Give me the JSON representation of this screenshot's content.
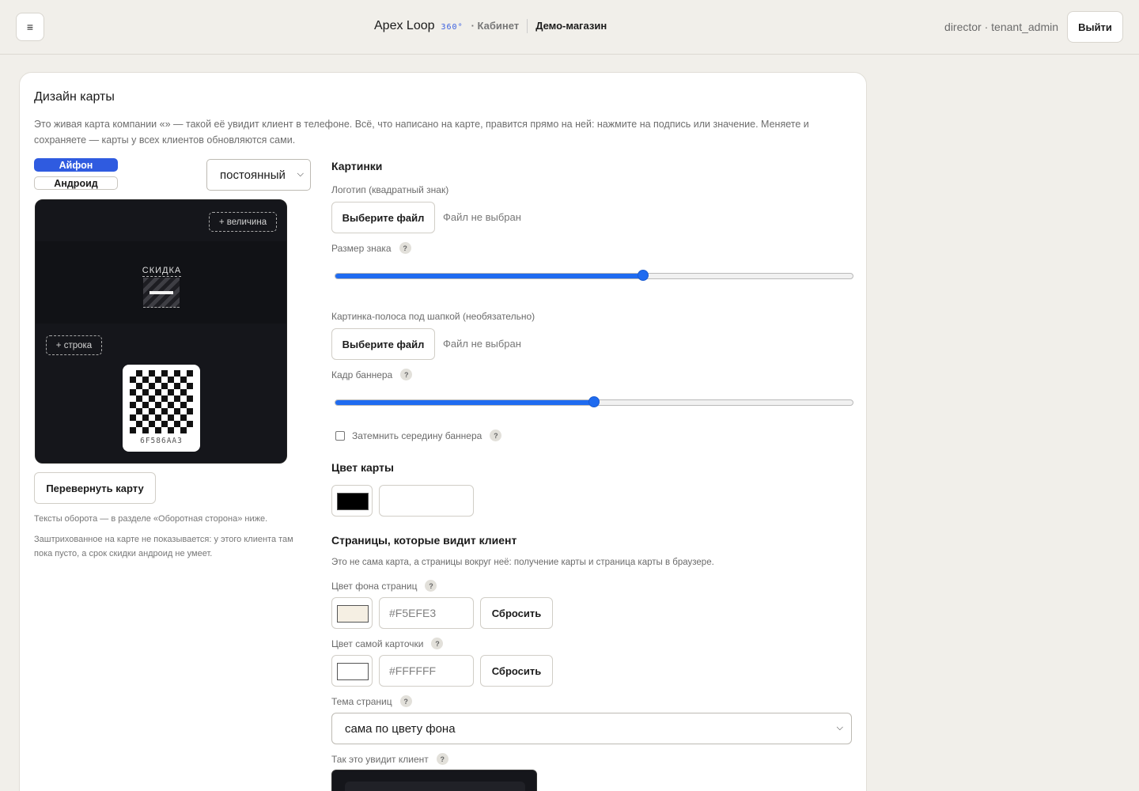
{
  "header": {
    "menu_icon": "≡",
    "brand_name": "Apex Loop",
    "brand_tag": "360°",
    "section": "· Кабинет",
    "shop": "Демо-магазин",
    "user": "director · tenant_admin",
    "logout_label": "Выйти"
  },
  "panel": {
    "title": "Дизайн карты",
    "description": "Это живая карта компании «» — такой её увидит клиент в телефоне. Всё, что написано на карте, правится прямо на ней: нажмите на подпись или значение. Меняете и сохраняете — карты у всех клиентов обновляются сами."
  },
  "preview": {
    "platforms": [
      "Айфон",
      "Андроид"
    ],
    "active_platform": "Айфон",
    "period_select": "постоянный",
    "add_value_label": "+ величина",
    "discount_label": "СКИДКА",
    "add_row_label": "+ строка",
    "card_code": "6F586AA3",
    "flip_label": "Перевернуть карту",
    "note_back": "Тексты оборота — в разделе «Оборотная сторона» ниже.",
    "note_hatched": "Заштрихованное на карте не показывается: у этого клиента там пока пусто, а срок скидки андроид не умеет."
  },
  "images": {
    "title": "Картинки",
    "logo_label": "Логотип (квадратный знак)",
    "choose_file": "Выберите файл",
    "no_file": "Файл не выбран",
    "logo_size_label": "Размер знака",
    "logo_size_value": 0.595,
    "banner_label": "Картинка-полоса под шапкой (необязательно)",
    "banner_frame_label": "Кадр баннера",
    "banner_frame_value": 0.5,
    "dim_banner_label": "Затемнить середину баннера",
    "dim_banner_checked": false,
    "help_icon": "?"
  },
  "card_color": {
    "title": "Цвет карты",
    "value": "#000000",
    "hex_text": ""
  },
  "pages": {
    "title": "Страницы, которые видит клиент",
    "description": "Это не сама карта, а страницы вокруг неё: получение карты и страница карты в браузере.",
    "bg_label": "Цвет фона страниц",
    "bg_color": "#F5EFE3",
    "bg_hex": "#F5EFE3",
    "card_label": "Цвет самой карточки",
    "card_color": "#FFFFFF",
    "card_hex": "#FFFFFF",
    "reset_label": "Сбросить",
    "theme_label": "Тема страниц",
    "theme_value": "сама по цвету фона",
    "preview_label": "Так это увидит клиент"
  },
  "colors": {
    "accent": "#2f5be0",
    "slider": "#1f6bf0",
    "card_bg": "#15161b"
  }
}
